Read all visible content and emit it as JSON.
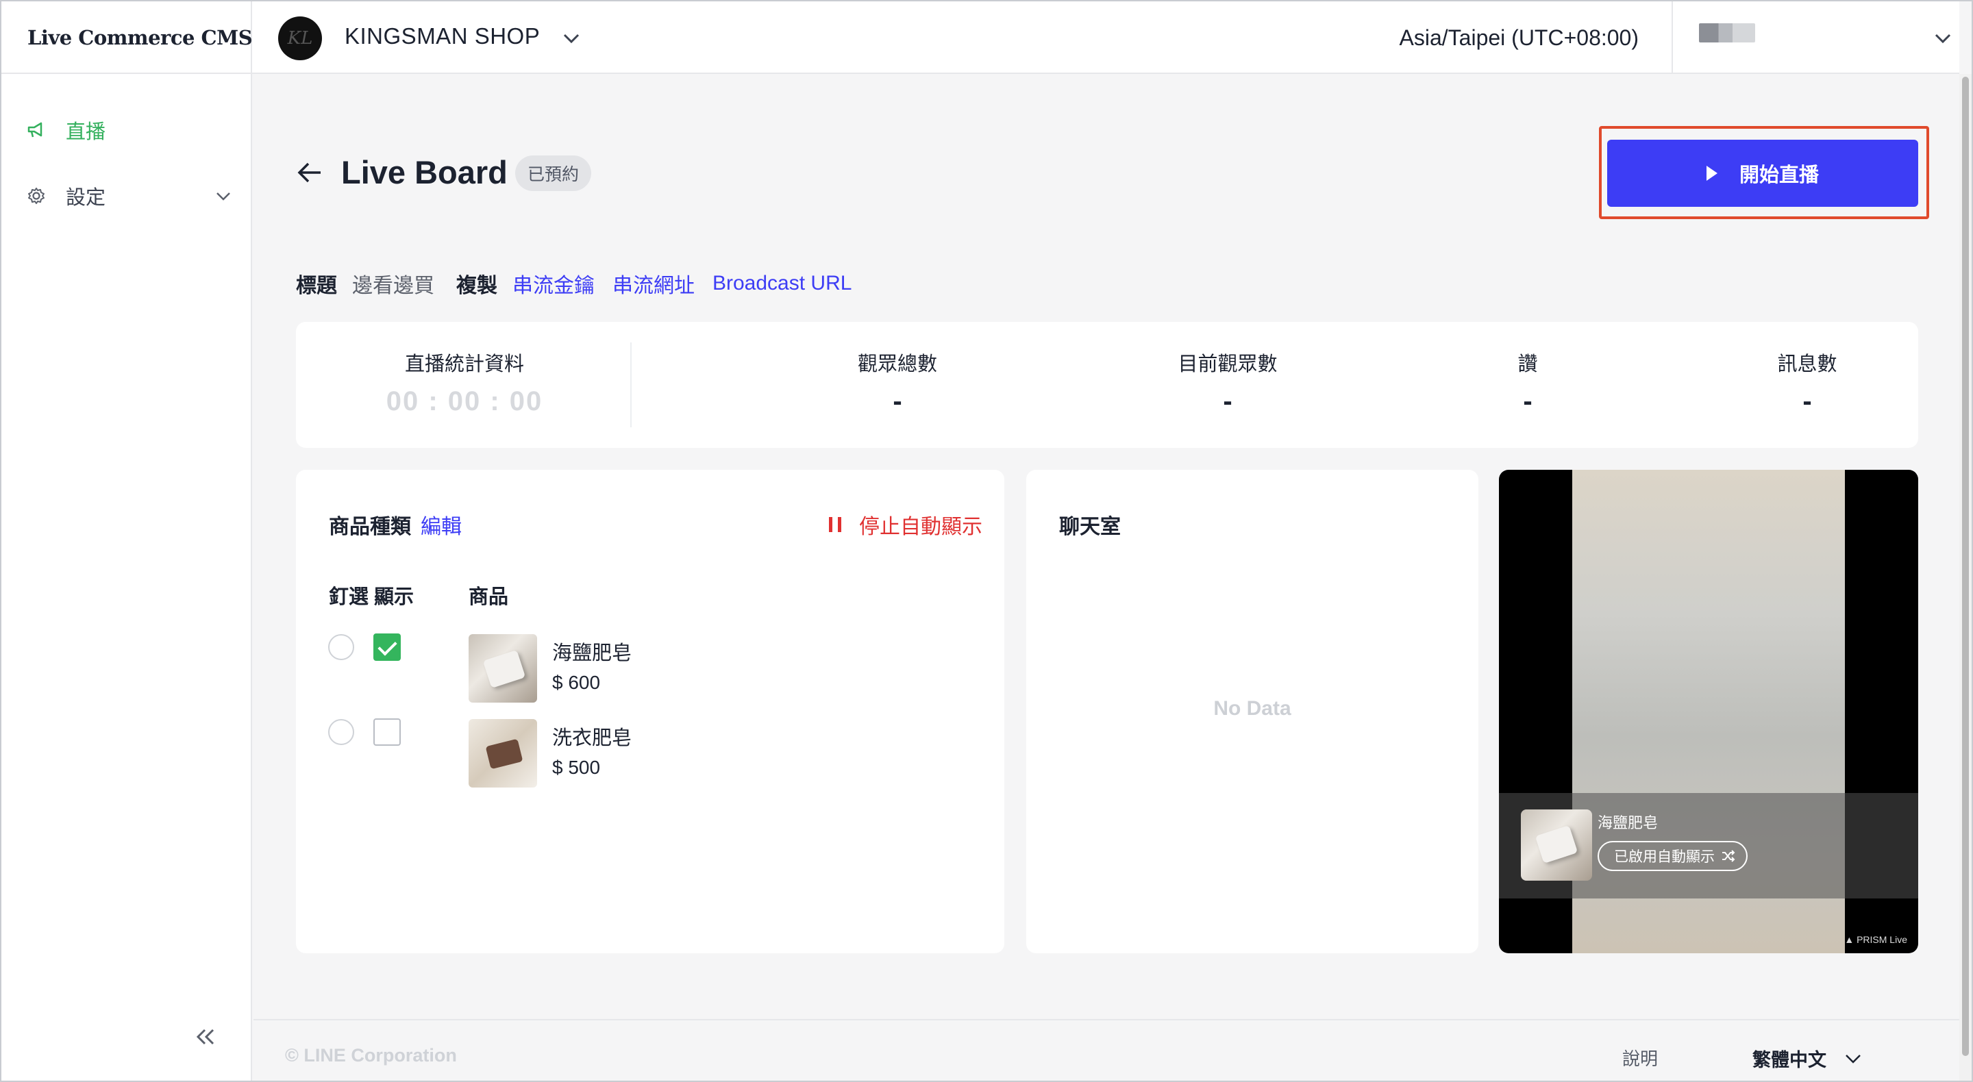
{
  "header": {
    "brand": "Live Commerce CMS",
    "shop_logo_text": "KL",
    "shop_name": "KINGSMAN SHOP",
    "timezone": "Asia/Taipei (UTC+08:00)"
  },
  "sidebar": {
    "items": [
      {
        "label": "直播",
        "icon": "megaphone-icon",
        "active": true
      },
      {
        "label": "設定",
        "icon": "gear-icon",
        "active": false
      }
    ]
  },
  "page": {
    "title": "Live Board",
    "status": "已預約",
    "start_button": "開始直播"
  },
  "info": {
    "title_label": "標題",
    "title_value": "邊看邊買",
    "copy_label": "複製",
    "links": [
      "串流金鑰",
      "串流網址",
      "Broadcast URL"
    ]
  },
  "stats": {
    "live_stats_label": "直播統計資料",
    "timer": "00 : 00 : 00",
    "items": [
      {
        "label": "觀眾總數",
        "value": "-"
      },
      {
        "label": "目前觀眾數",
        "value": "-"
      },
      {
        "label": "讚",
        "value": "-"
      },
      {
        "label": "訊息數",
        "value": "-"
      }
    ]
  },
  "products": {
    "title": "商品種類",
    "edit": "編輯",
    "stop_auto_display": "停止自動顯示",
    "col_pin": "釘選",
    "col_show": "顯示",
    "col_product": "商品",
    "rows": [
      {
        "name": "海鹽肥皂",
        "price": "$ 600",
        "pinned": false,
        "shown": true
      },
      {
        "name": "洗衣肥皂",
        "price": "$ 500",
        "pinned": false,
        "shown": false
      }
    ]
  },
  "chat": {
    "title": "聊天室",
    "empty": "No Data"
  },
  "preview": {
    "product_name": "海鹽肥皂",
    "auto_display_label": "已啟用自動顯示",
    "watermark": "PRISM Live"
  },
  "footer": {
    "copyright": "© LINE Corporation",
    "help": "說明",
    "language": "繁體中文"
  },
  "colors": {
    "accent": "#3d3df5",
    "active_green": "#33b05d",
    "danger": "#e03131",
    "highlight_outline": "#e04a2c"
  }
}
